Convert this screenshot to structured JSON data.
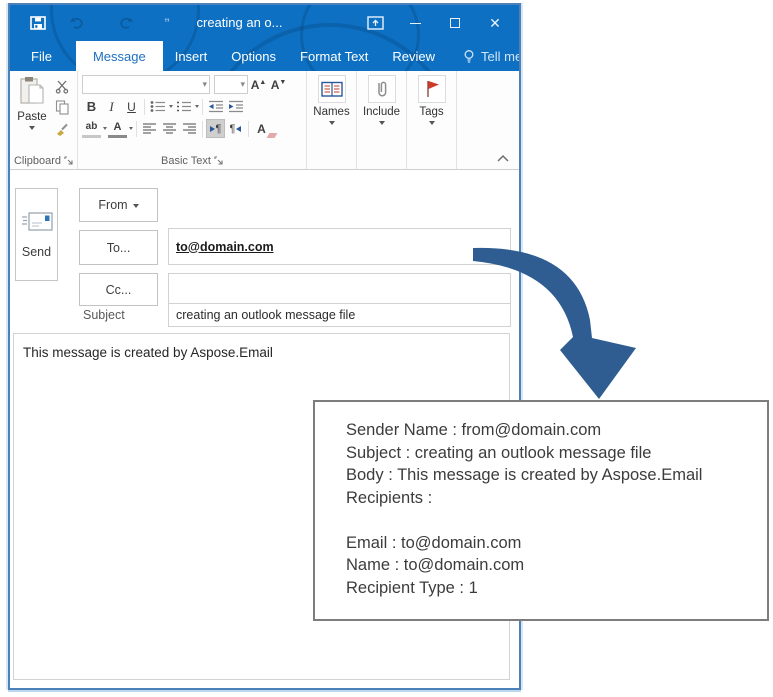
{
  "titlebar": {
    "title": "creating an o...",
    "qat_quotes": "”"
  },
  "tabs": [
    {
      "label": "File",
      "active": false
    },
    {
      "label": "Message",
      "active": true
    },
    {
      "label": "Insert",
      "active": false
    },
    {
      "label": "Options",
      "active": false
    },
    {
      "label": "Format Text",
      "active": false
    },
    {
      "label": "Review",
      "active": false
    },
    {
      "label": "Tell me...",
      "active": false
    }
  ],
  "ribbon": {
    "paste_label": "Paste",
    "clipboard_label": "Clipboard",
    "basic_text_label": "Basic Text",
    "bold": "B",
    "italic": "I",
    "underline": "U",
    "grow_font": "A",
    "shrink_font": "A",
    "highlight": "ab",
    "font_color": "A",
    "clear_format": "A",
    "pilcrow": "¶",
    "names_label": "Names",
    "include_label": "Include",
    "tags_label": "Tags"
  },
  "compose": {
    "send_label": "Send",
    "from_label": "From",
    "to_label": "To...",
    "cc_label": "Cc...",
    "subject_label": "Subject",
    "to_value": "to@domain.com",
    "cc_value": "",
    "subject_value": "creating an outlook message file",
    "body_text": "This message is created by Aspose.Email"
  },
  "callout": {
    "lines": [
      "Sender Name : from@domain.com",
      "Subject : creating an outlook message file",
      "Body : This message is created by Aspose.Email",
      "Recipients :",
      "",
      "Email : to@domain.com",
      "Name : to@domain.com",
      "Recipient Type : 1"
    ]
  },
  "colors": {
    "titlebar_blue": "#0e70c2",
    "arrow_blue": "#2f5d92",
    "flag_red": "#cf3a2b",
    "tab_active_text": "#1e6fc0",
    "window_border": "#4b81b8"
  }
}
